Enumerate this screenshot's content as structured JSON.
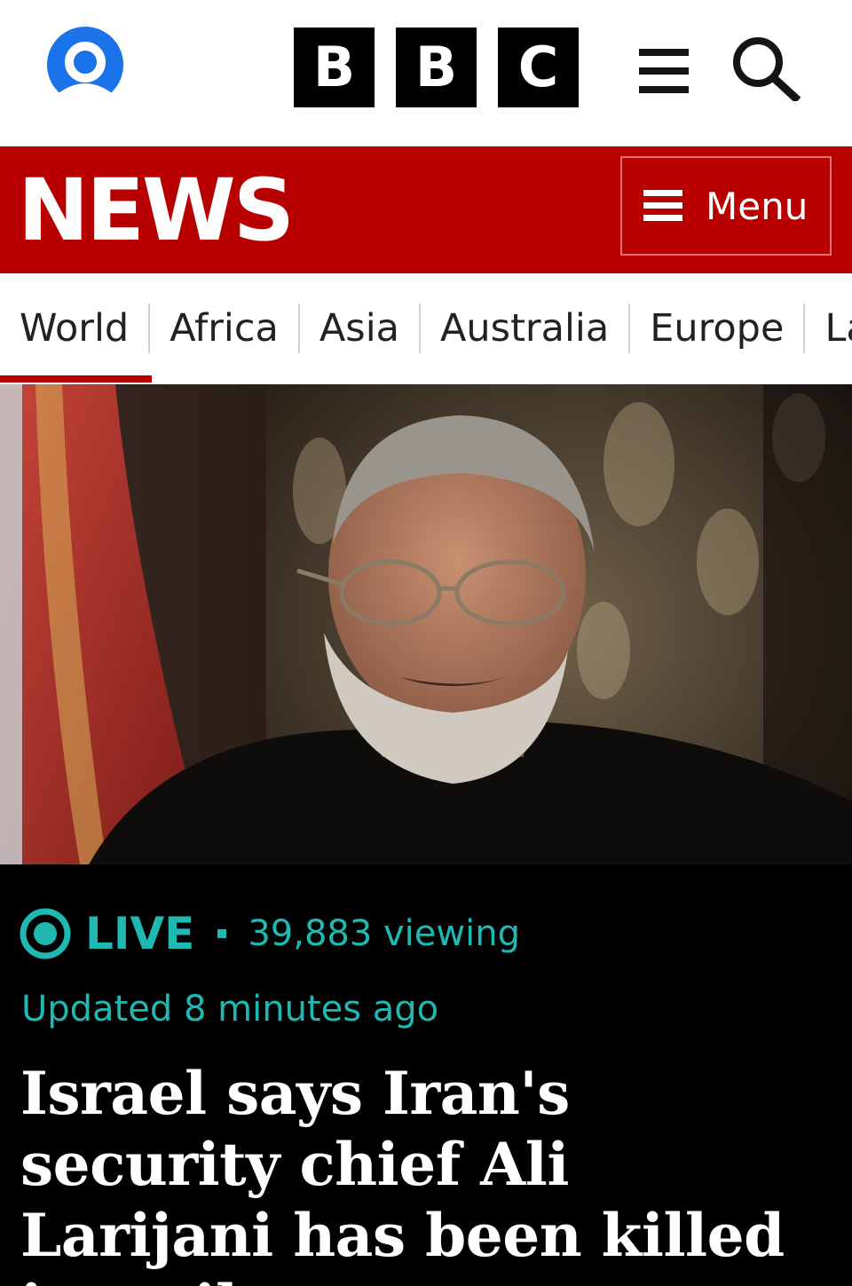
{
  "brand": {
    "logo_letters": [
      "B",
      "B",
      "C"
    ],
    "section_title": "NEWS",
    "colors": {
      "news_red": "#b80000",
      "live_teal": "#1fb8b2",
      "account_blue": "#1a73e8"
    }
  },
  "header": {
    "account_icon": "account-icon",
    "hamburger_icon": "hamburger-icon",
    "search_icon": "search-icon"
  },
  "news_menu": {
    "label": "Menu",
    "icon": "menu-lines-icon"
  },
  "nav": {
    "tabs": [
      {
        "label": "World",
        "active": true
      },
      {
        "label": "Africa",
        "active": false
      },
      {
        "label": "Asia",
        "active": false
      },
      {
        "label": "Australia",
        "active": false
      },
      {
        "label": "Europe",
        "active": false
      },
      {
        "label": "Latin America",
        "active": false
      }
    ]
  },
  "article": {
    "live_label": "LIVE",
    "viewers": "39,883 viewing",
    "updated": "Updated 8 minutes ago",
    "headline": "Israel says Iran's security chief Ali Larijani has been killed in strike"
  }
}
